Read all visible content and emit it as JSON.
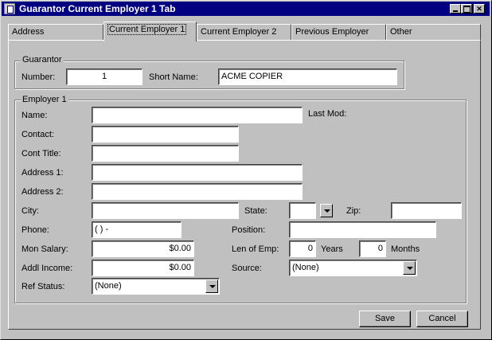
{
  "window": {
    "title": "Guarantor Current Employer 1 Tab"
  },
  "tabs": [
    {
      "label": "Address"
    },
    {
      "label": "Current Employer 1"
    },
    {
      "label": "Current Employer 2"
    },
    {
      "label": "Previous Employer"
    },
    {
      "label": "Other"
    }
  ],
  "guarantor": {
    "legend": "Guarantor",
    "number_label": "Number:",
    "number_value": "1",
    "short_name_label": "Short Name:",
    "short_name_value": "ACME COPIER"
  },
  "employer": {
    "legend": "Employer 1",
    "name_label": "Name:",
    "name_value": "",
    "last_mod_label": "Last Mod:",
    "contact_label": "Contact:",
    "contact_value": "",
    "cont_title_label": "Cont Title:",
    "cont_title_value": "",
    "address1_label": "Address 1:",
    "address1_value": "",
    "address2_label": "Address 2:",
    "address2_value": "",
    "city_label": "City:",
    "city_value": "",
    "state_label": "State:",
    "state_value": "",
    "zip_label": "Zip:",
    "zip_value": "",
    "phone_label": "Phone:",
    "phone_value": "(   )    -",
    "position_label": "Position:",
    "position_value": "",
    "mon_salary_label": "Mon Salary:",
    "mon_salary_value": "$0.00",
    "len_emp_label": "Len of Emp:",
    "years_value": "0",
    "years_label": "Years",
    "months_value": "0",
    "months_label": "Months",
    "addl_income_label": "Addl Income:",
    "addl_income_value": "$0.00",
    "source_label": "Source:",
    "source_value": "(None)",
    "ref_status_label": "Ref Status:",
    "ref_status_value": "(None)"
  },
  "buttons": {
    "save": "Save",
    "cancel": "Cancel"
  }
}
